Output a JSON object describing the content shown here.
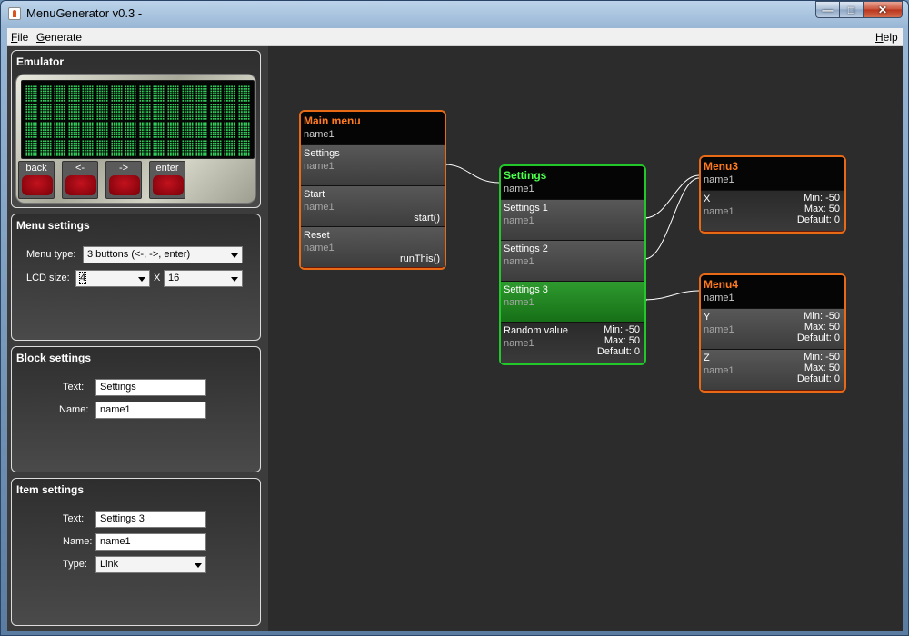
{
  "window": {
    "title": "MenuGenerator v0.3 -"
  },
  "menubar": {
    "file": {
      "key": "F",
      "rest": "ile"
    },
    "generate": {
      "key": "G",
      "rest": "enerate"
    },
    "help": {
      "key": "H",
      "rest": "elp"
    }
  },
  "emulator": {
    "title": "Emulator",
    "buttons": [
      "back",
      "<-",
      "->",
      "enter"
    ]
  },
  "menu_settings": {
    "title": "Menu settings",
    "menu_type_label": "Menu type:",
    "menu_type_value": "3 buttons (<-, ->, enter)",
    "lcd_size_label": "LCD size:",
    "lcd_rows": "4",
    "lcd_x": "X",
    "lcd_cols": "16"
  },
  "block_settings": {
    "title": "Block settings",
    "text_label": "Text:",
    "text_value": "Settings",
    "name_label": "Name:",
    "name_value": "name1"
  },
  "item_settings": {
    "title": "Item settings",
    "text_label": "Text:",
    "text_value": "Settings 3",
    "name_label": "Name:",
    "name_value": "name1",
    "type_label": "Type:",
    "type_value": "Link"
  },
  "blocks": {
    "main_menu": {
      "title": "Main menu",
      "name": "name1",
      "items": [
        {
          "text": "Settings",
          "name": "name1",
          "action": ""
        },
        {
          "text": "Start",
          "name": "name1",
          "action": "start()"
        },
        {
          "text": "Reset",
          "name": "name1",
          "action": "runThis()"
        }
      ]
    },
    "settings": {
      "title": "Settings",
      "name": "name1",
      "items": [
        {
          "text": "Settings 1",
          "name": "name1"
        },
        {
          "text": "Settings 2",
          "name": "name1"
        },
        {
          "text": "Settings 3",
          "name": "name1"
        },
        {
          "text": "Random value",
          "name": "name1",
          "min": "Min: -50",
          "max": "Max: 50",
          "default": "Default: 0"
        }
      ]
    },
    "menu3": {
      "title": "Menu3",
      "name": "name1",
      "items": [
        {
          "text": "X",
          "name": "name1",
          "min": "Min: -50",
          "max": "Max: 50",
          "default": "Default: 0"
        }
      ]
    },
    "menu4": {
      "title": "Menu4",
      "name": "name1",
      "items": [
        {
          "text": "Y",
          "name": "name1",
          "min": "Min: -50",
          "max": "Max: 50",
          "default": "Default: 0"
        },
        {
          "text": "Z",
          "name": "name1",
          "min": "Min: -50",
          "max": "Max: 50",
          "default": "Default: 0"
        }
      ]
    }
  },
  "colors": {
    "orange_border": "#e86a17",
    "green_border": "#22c82a",
    "lcd_pixel": "#2fd05a",
    "canvas": "#2c2c2c"
  }
}
